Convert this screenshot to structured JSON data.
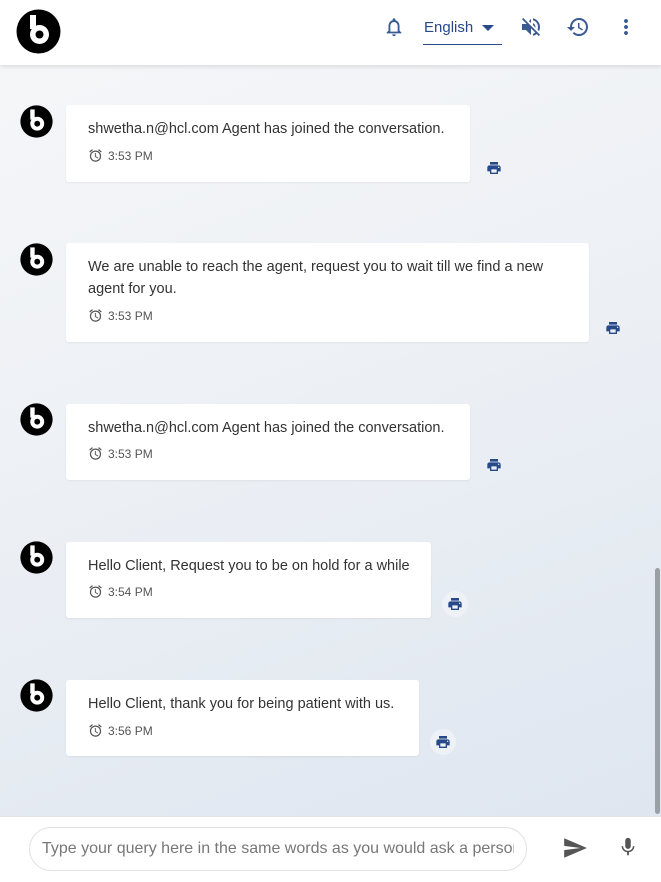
{
  "header": {
    "language": "English",
    "icons": {
      "logo": "brand-logo",
      "notifications": "bell-icon",
      "mute": "volume-off-icon",
      "history": "history-icon",
      "menu": "more-vert-icon"
    }
  },
  "messages": [
    {
      "text": "shwetha.n@hcl.com Agent has joined the conversation.",
      "time": "3:53 PM"
    },
    {
      "text": "We are unable to reach the agent, request you to wait till we find a new agent for you.",
      "time": "3:53 PM"
    },
    {
      "text": "shwetha.n@hcl.com Agent has joined the conversation.",
      "time": "3:53 PM"
    },
    {
      "text": "Hello Client, Request you to be on hold for a while",
      "time": "3:54 PM"
    },
    {
      "text": "Hello Client, thank you for being patient with us.",
      "time": "3:56 PM"
    }
  ],
  "composer": {
    "placeholder": "Type your query here in the same words as you would ask a person."
  },
  "colors": {
    "accent": "#27498a",
    "icon": "#3a5a93"
  }
}
